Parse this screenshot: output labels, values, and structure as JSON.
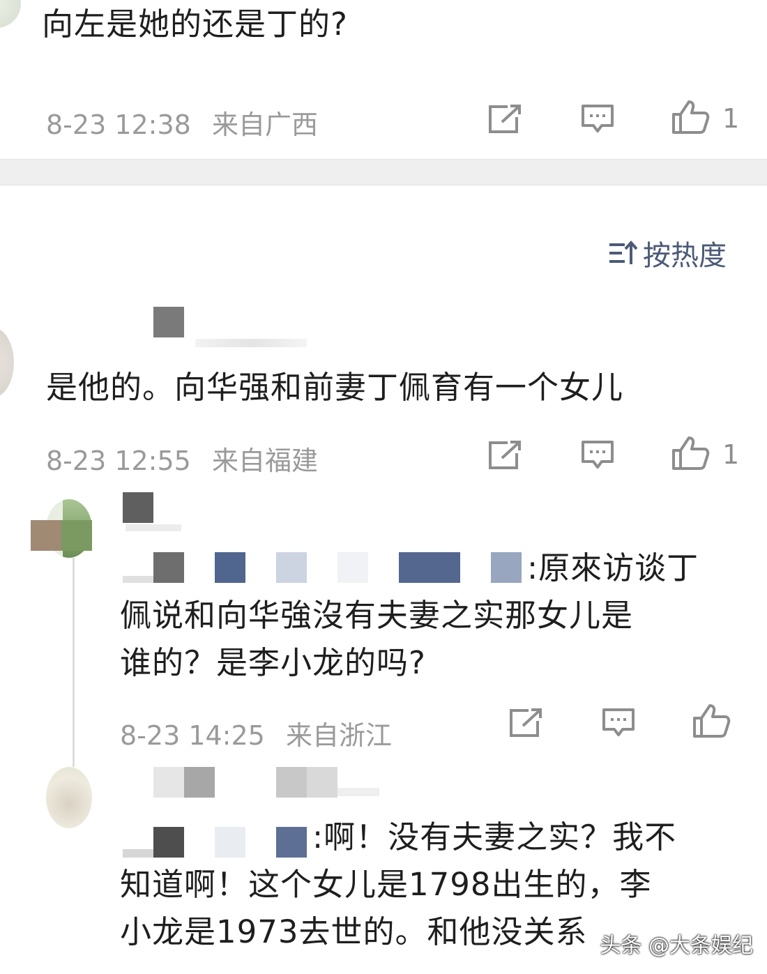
{
  "comment1": {
    "text": "向左是她的还是丁的?",
    "time": "8-23 12:38",
    "location": "来自广西",
    "likes": "1"
  },
  "sort": {
    "label": "按热度"
  },
  "comment2": {
    "text": "是他的。向华强和前妻丁佩育有一个女儿",
    "time": "8-23 12:55",
    "location": "来自福建",
    "likes": "1"
  },
  "reply1": {
    "text_line1": ":原來访谈丁",
    "text_line2": "佩说和向华強沒有夫妻之实那女儿是",
    "text_line3": "谁的？是李小龙的吗?",
    "time": "8-23 14:25",
    "location": "来自浙江"
  },
  "reply2": {
    "text_line1": ":啊！没有夫妻之实？我不",
    "text_line2": "知道啊！这个女儿是1798出生的，李",
    "text_line3": "小龙是1973去世的。和他没关系"
  },
  "watermark": {
    "label": "头条 @大条娱纪"
  },
  "icons": [
    "share-icon",
    "comment-icon",
    "thumb-up-icon",
    "sort-icon"
  ],
  "colors": {
    "meta_gray": "#9a9a9a",
    "sort_blue": "#4c5a78",
    "band": "#efefef"
  }
}
